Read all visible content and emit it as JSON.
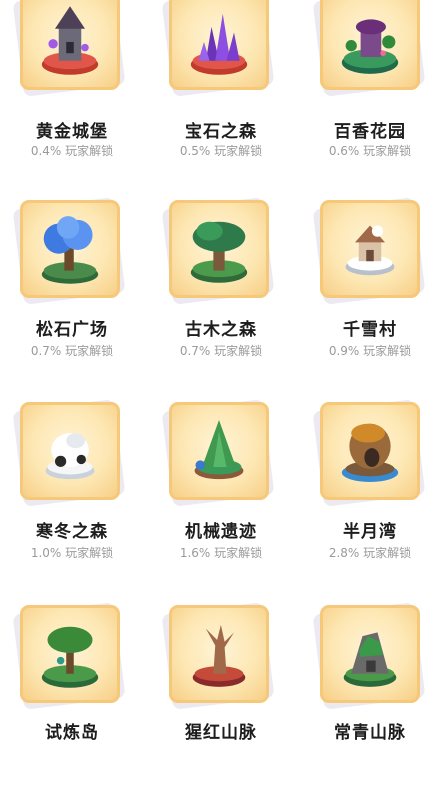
{
  "maps": [
    {
      "name": "黄金城堡",
      "rate": "0.4% 玩家解锁",
      "icon": "castle-tower-icon"
    },
    {
      "name": "宝石之森",
      "rate": "0.5% 玩家解锁",
      "icon": "crystal-cluster-icon"
    },
    {
      "name": "百香花园",
      "rate": "0.6% 玩家解锁",
      "icon": "flower-garden-icon"
    },
    {
      "name": "松石广场",
      "rate": "0.7% 玩家解锁",
      "icon": "blue-tree-icon"
    },
    {
      "name": "古木之森",
      "rate": "0.7% 玩家解锁",
      "icon": "ancient-tree-icon"
    },
    {
      "name": "千雪村",
      "rate": "0.9% 玩家解锁",
      "icon": "snow-village-icon"
    },
    {
      "name": "寒冬之森",
      "rate": "1.0% 玩家解锁",
      "icon": "snow-rock-icon"
    },
    {
      "name": "机械遗迹",
      "rate": "1.6% 玩家解锁",
      "icon": "green-peak-icon"
    },
    {
      "name": "半月湾",
      "rate": "2.8% 玩家解锁",
      "icon": "cave-island-icon"
    },
    {
      "name": "试炼岛",
      "rate": "",
      "icon": "trial-tree-icon"
    },
    {
      "name": "猩红山脉",
      "rate": "",
      "icon": "red-driftwood-icon"
    },
    {
      "name": "常青山脉",
      "rate": "",
      "icon": "green-mountain-icon"
    }
  ]
}
